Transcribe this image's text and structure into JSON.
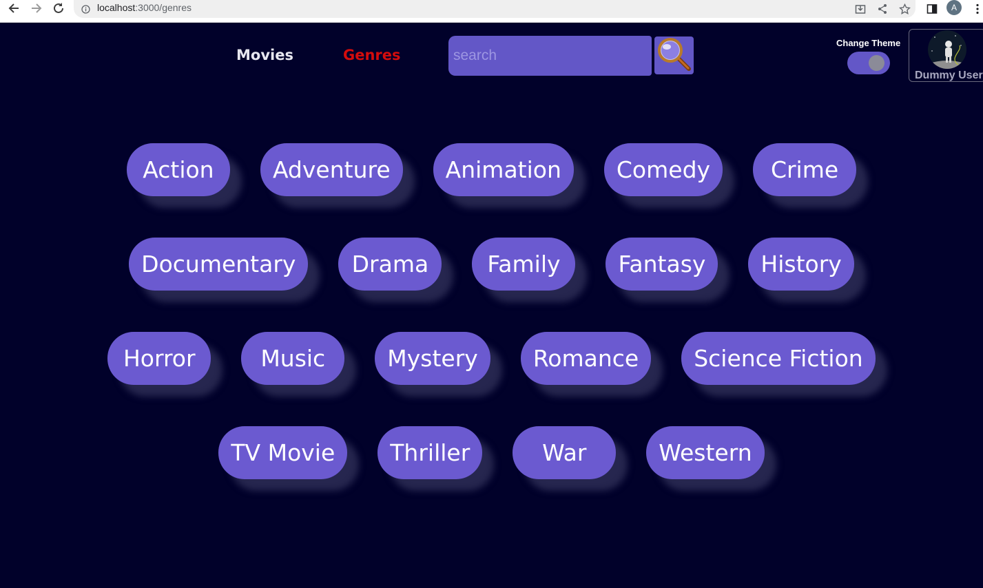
{
  "browser": {
    "url_host": "localhost",
    "url_path": ":3000/genres",
    "profile_initial": "A"
  },
  "header": {
    "nav": [
      {
        "label": "Movies",
        "color": "#e8e8f0",
        "active": false
      },
      {
        "label": "Genres",
        "color": "#d40c0c",
        "active": true
      }
    ],
    "search": {
      "placeholder": "search",
      "value": ""
    },
    "theme_label": "Change Theme",
    "user_name": "Dummy User"
  },
  "genres": [
    [
      "Action",
      "Adventure",
      "Animation",
      "Comedy",
      "Crime"
    ],
    [
      "Documentary",
      "Drama",
      "Family",
      "Fantasy",
      "History"
    ],
    [
      "Horror",
      "Music",
      "Mystery",
      "Romance",
      "Science Fiction"
    ],
    [
      "TV Movie",
      "Thriller",
      "War",
      "Western"
    ]
  ],
  "colors": {
    "background": "#01012a",
    "pill": "#6b5ad0",
    "accent": "#6357c7"
  }
}
